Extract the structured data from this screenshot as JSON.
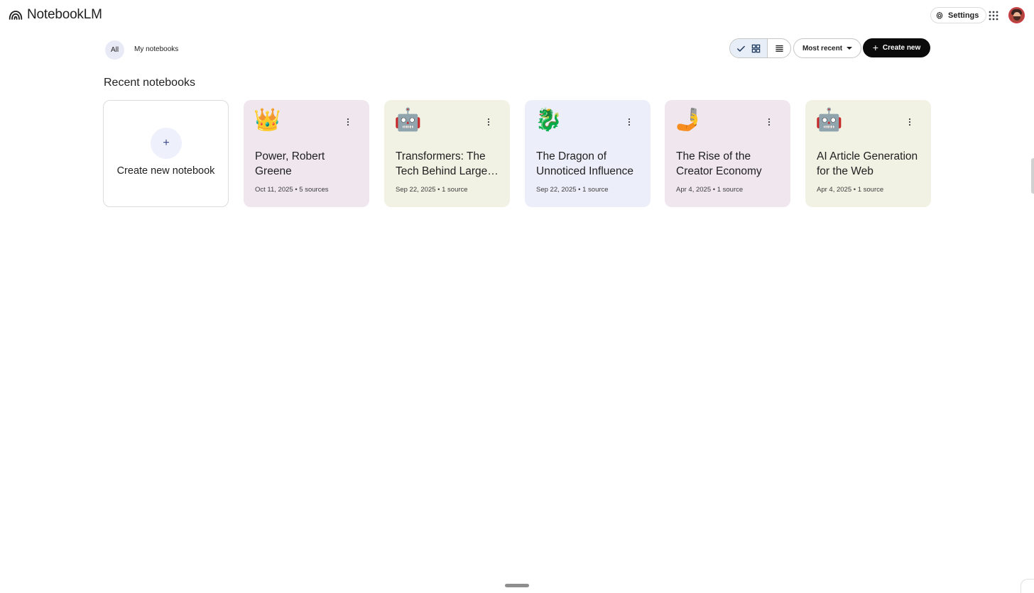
{
  "app": {
    "title": "NotebookLM",
    "logo_icon": "notebooklm-logo-icon"
  },
  "header": {
    "settings_label": "Settings",
    "settings_icon": "gear-icon",
    "apps_icon": "apps-grid-icon",
    "avatar_icon": "user-avatar"
  },
  "filters": {
    "all_label": "All",
    "my_notebooks_label": "My notebooks"
  },
  "toolbar": {
    "grid_view_icon": "grid-view-icon",
    "list_view_icon": "list-view-icon",
    "sort_label": "Most recent",
    "create_label": "Create new"
  },
  "section": {
    "title": "Recent notebooks"
  },
  "create_card": {
    "label": "Create new notebook"
  },
  "notebooks": [
    {
      "emoji": "👑",
      "title": "Power, Robert Greene",
      "meta": "Oct 11, 2025 • 5 sources",
      "color": "#efe6ee"
    },
    {
      "emoji": "🤖",
      "title": "Transformers: The Tech Behind Large Language Models",
      "meta": "Sep 22, 2025 • 1 source",
      "color": "#f1f1e4"
    },
    {
      "emoji": "🐉",
      "title": "The Dragon of Unnoticed Influence",
      "meta": "Sep 22, 2025 • 1 source",
      "color": "#eceefa"
    },
    {
      "emoji": "🤳",
      "title": "The Rise of the Creator Economy",
      "meta": "Apr 4, 2025 • 1 source",
      "color": "#efe6ee"
    },
    {
      "emoji": "🤖",
      "title": "AI Article Generation for the Web",
      "meta": "Apr 4, 2025 • 1 source",
      "color": "#f1f1e4"
    }
  ]
}
